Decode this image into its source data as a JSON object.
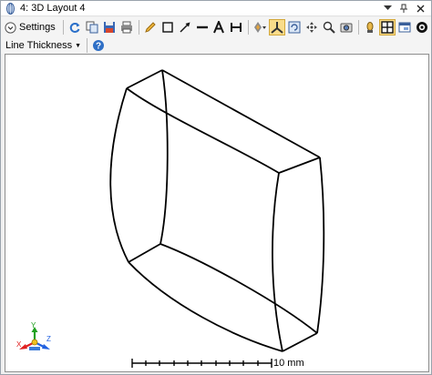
{
  "window": {
    "title": "4: 3D Layout 4",
    "title_icon": "3d-layout-icon",
    "controls": [
      "dropdown-arrow-icon",
      "pin-icon",
      "close-icon"
    ]
  },
  "toolbar": {
    "settings_label": "Settings",
    "tools": [
      "refresh-icon",
      "copy-icon",
      "save-icon",
      "print-icon",
      "pencil-icon",
      "rectangle-icon",
      "arrow-icon",
      "line-icon",
      "text-icon",
      "dimension-icon",
      "rotate-tool-icon",
      "axis-icon",
      "orbit-icon",
      "pan-icon",
      "zoom-icon",
      "camera-icon",
      "lens-icon",
      "layout-icon",
      "window-icon",
      "lock-icon"
    ]
  },
  "toolbar2": {
    "line_thickness_label": "Line Thickness",
    "help_icon": "help-icon"
  },
  "viewport": {
    "scale_bar_label": "10 mm",
    "axis_labels": {
      "x": "X",
      "y": "Y",
      "z": "Z"
    },
    "colors": {
      "x_axis": "#e02020",
      "y_axis": "#20a020",
      "z_axis": "#2060e0",
      "lens_line": "#000000"
    }
  }
}
